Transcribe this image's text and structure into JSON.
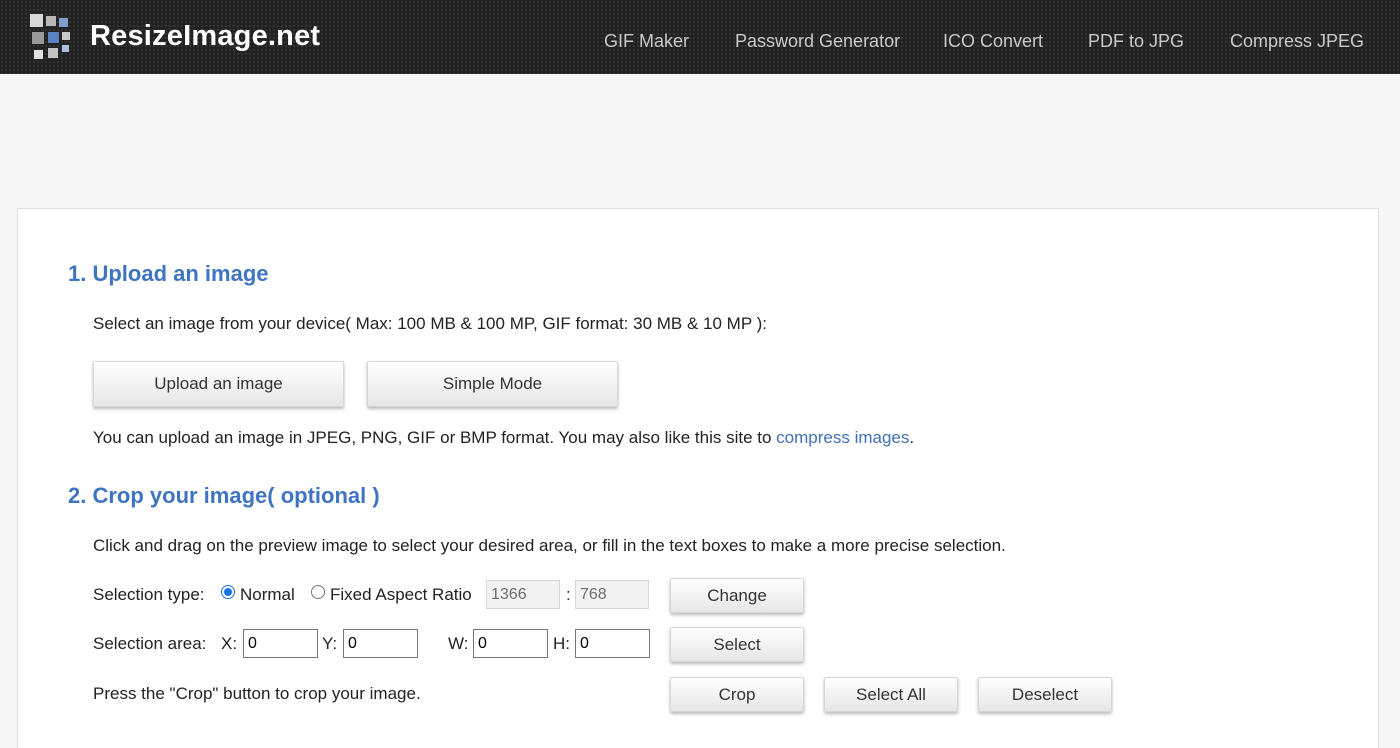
{
  "header": {
    "logo_text": "ResizeImage.net",
    "nav": [
      "GIF Maker",
      "Password Generator",
      "ICO Convert",
      "PDF to JPG",
      "Compress JPEG"
    ]
  },
  "upload": {
    "heading": "1. Upload an image",
    "description": "Select an image from your device( Max: 100 MB & 100 MP, GIF format: 30 MB & 10 MP ):",
    "upload_button": "Upload an image",
    "simple_button": "Simple Mode",
    "note_prefix": "You can upload an image in JPEG, PNG, GIF or BMP format. You may also like this site to ",
    "note_link": "compress images",
    "note_suffix": "."
  },
  "crop": {
    "heading": "2. Crop your image( optional )",
    "description": "Click and drag on the preview image to select your desired area, or fill in the text boxes to make a more precise selection.",
    "selection_type_label": "Selection type:",
    "normal_label": "Normal",
    "fixed_label": "Fixed Aspect Ratio",
    "ratio_w": "1366",
    "ratio_sep": ":",
    "ratio_h": "768",
    "change_button": "Change",
    "selection_area_label": "Selection area:",
    "x_label": "X:",
    "x_value": "0",
    "y_label": "Y:",
    "y_value": "0",
    "w_label": "W:",
    "w_value": "0",
    "h_label": "H:",
    "h_value": "0",
    "select_button": "Select",
    "crop_note": "Press the \"Crop\" button to crop your image.",
    "crop_button": "Crop",
    "select_all_button": "Select All",
    "deselect_button": "Deselect"
  },
  "icons": [
    "logo-tiles-icon"
  ],
  "colors": {
    "heading": "#3f74c2",
    "link": "#3f6fb4",
    "header_bg": "#222222"
  }
}
